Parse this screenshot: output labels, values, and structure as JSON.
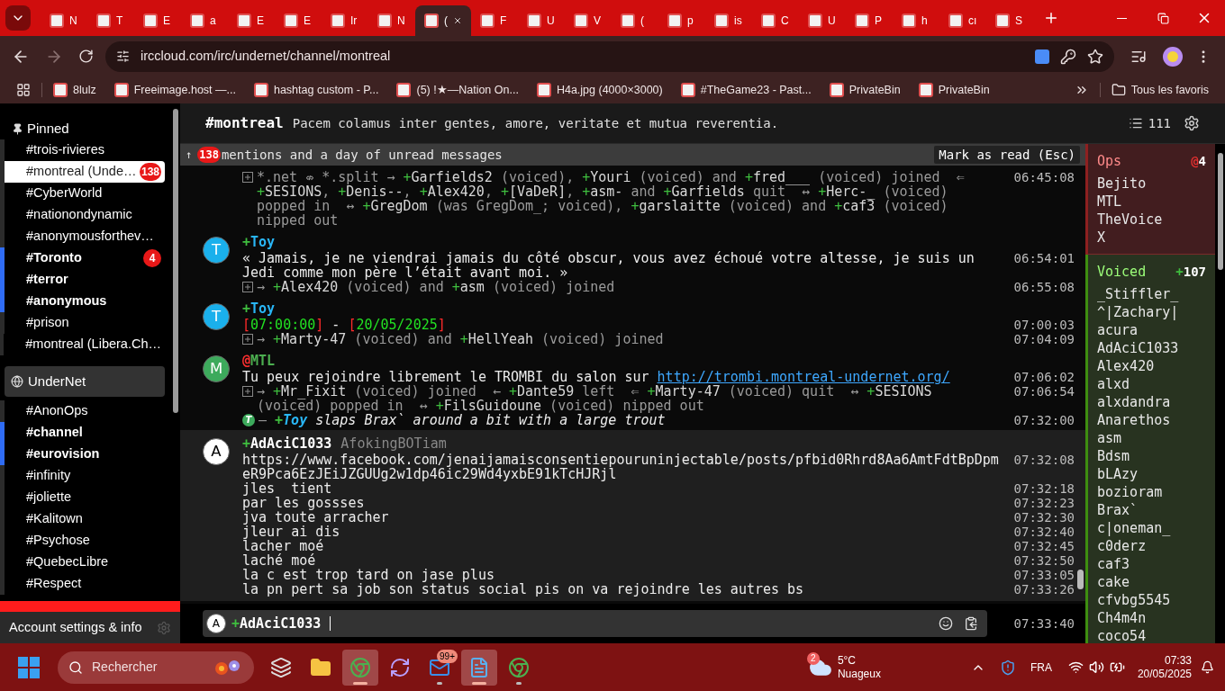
{
  "browser": {
    "tabs": [
      {
        "label": "N",
        "selected": false
      },
      {
        "label": "T",
        "selected": false
      },
      {
        "label": "E",
        "selected": false
      },
      {
        "label": "a",
        "selected": false
      },
      {
        "label": "E",
        "selected": false
      },
      {
        "label": "E",
        "selected": false
      },
      {
        "label": "Ir",
        "selected": false
      },
      {
        "label": "N",
        "selected": false
      },
      {
        "label": "(",
        "selected": true
      },
      {
        "label": "F",
        "selected": false
      },
      {
        "label": "U",
        "selected": false
      },
      {
        "label": "V",
        "selected": false
      },
      {
        "label": "(",
        "selected": false
      },
      {
        "label": "p",
        "selected": false
      },
      {
        "label": "is",
        "selected": false
      },
      {
        "label": "C",
        "selected": false
      },
      {
        "label": "U",
        "selected": false
      },
      {
        "label": "P",
        "selected": false
      },
      {
        "label": "h",
        "selected": false
      },
      {
        "label": "cı",
        "selected": false
      },
      {
        "label": "S",
        "selected": false
      }
    ],
    "address": "irccloud.com/irc/undernet/channel/montreal",
    "bookmarks": [
      "8lulz",
      "Freeimage.host —...",
      "hashtag custom - P...",
      "(5) !★—Nation On...",
      "H4a.jpg (4000×3000)",
      "#TheGame23 - Past...",
      "PrivateBin",
      "PrivateBin"
    ],
    "all_bookmarks": "Tous les favoris"
  },
  "sidebar": {
    "pinned_title": "Pinned",
    "pinned": [
      {
        "name": "#trois-rivieres",
        "bold": false,
        "selected": false
      },
      {
        "name": "#montreal (Unde…",
        "bold": false,
        "selected": true,
        "badge": "138"
      },
      {
        "name": "#CyberWorld",
        "bold": false,
        "selected": false
      },
      {
        "name": "#nationondynamic",
        "bold": false,
        "selected": false
      },
      {
        "name": "#anonymousforthev…",
        "bold": false,
        "selected": false
      },
      {
        "name": "#Toronto",
        "bold": true,
        "selected": false,
        "badge": "4"
      },
      {
        "name": "#terror",
        "bold": true,
        "selected": false
      },
      {
        "name": "#anonymous",
        "bold": true,
        "selected": false
      },
      {
        "name": "#prison",
        "bold": false,
        "selected": false
      },
      {
        "name": "#montreal (Libera.Ch…",
        "bold": false,
        "selected": false
      }
    ],
    "network": "UnderNet",
    "channels": [
      {
        "name": "#AnonOps",
        "bold": false,
        "selected": false
      },
      {
        "name": "#channel",
        "bold": true,
        "selected": false
      },
      {
        "name": "#eurovision",
        "bold": true,
        "selected": false
      },
      {
        "name": "#infinity",
        "bold": false,
        "selected": false
      },
      {
        "name": "#joliette",
        "bold": false,
        "selected": false
      },
      {
        "name": "#Kalitown",
        "bold": false,
        "selected": false
      },
      {
        "name": "#Psychose",
        "bold": false,
        "selected": false
      },
      {
        "name": "#QuebecLibre",
        "bold": false,
        "selected": false
      },
      {
        "name": "#Respect",
        "bold": false,
        "selected": false
      }
    ],
    "footer": "Account settings & info"
  },
  "channel": {
    "name": "#montreal",
    "topic": "Pacem colamus inter gentes, amore, veritate et mutua reverentia.",
    "member_count": "111"
  },
  "unread_banner": {
    "arrow": "↑",
    "count": "138",
    "text": "mentions and a day of unread messages",
    "button": "Mark as read (Esc)"
  },
  "messages": [
    {
      "highlighted": false,
      "lines": [
        {
          "kind": "event",
          "time": "06:45:08",
          "segments": [
            {
              "kind": "dim",
              "text": "*.net ⇎ *.split → "
            },
            {
              "kind": "voiced",
              "mode": "+",
              "text": "Garfields2"
            },
            {
              "kind": "dim",
              "text": " (voiced), "
            },
            {
              "kind": "voiced",
              "mode": "+",
              "text": "Youri"
            },
            {
              "kind": "dim",
              "text": " (voiced) and "
            },
            {
              "kind": "voiced",
              "mode": "+",
              "text": "fred___"
            },
            {
              "kind": "dim",
              "text": " (voiced) joined  ⇐ "
            },
            {
              "kind": "voiced",
              "mode": "+",
              "text": "SESIONS"
            },
            {
              "kind": "dim",
              "text": ", "
            },
            {
              "kind": "voiced",
              "mode": "+",
              "text": "Denis--"
            },
            {
              "kind": "dim",
              "text": ", "
            },
            {
              "kind": "voiced",
              "mode": "+",
              "text": "Alex420"
            },
            {
              "kind": "dim",
              "text": ", "
            },
            {
              "kind": "voiced",
              "mode": "+",
              "text": "[VaDeR]"
            },
            {
              "kind": "dim",
              "text": ", "
            },
            {
              "kind": "voiced",
              "mode": "+",
              "text": "asm-"
            },
            {
              "kind": "dim",
              "text": " and "
            },
            {
              "kind": "voiced",
              "mode": "+",
              "text": "Garfields"
            },
            {
              "kind": "dim",
              "text": " quit  ↔ "
            },
            {
              "kind": "voiced",
              "mode": "+",
              "text": "Herc-_"
            },
            {
              "kind": "dim",
              "text": " (voiced) popped in  ↔ "
            },
            {
              "kind": "voiced",
              "mode": "+",
              "text": "GregDom"
            },
            {
              "kind": "dim",
              "text": " (was GregDom_; voiced), "
            },
            {
              "kind": "voiced",
              "mode": "+",
              "text": "garslaitte"
            },
            {
              "kind": "dim",
              "text": " (voiced) and "
            },
            {
              "kind": "voiced",
              "mode": "+",
              "text": "caf3"
            },
            {
              "kind": "dim",
              "text": " (voiced) nipped out"
            }
          ]
        }
      ]
    },
    {
      "highlighted": false,
      "avatar": {
        "letter": "T",
        "color": "#1ab0ec"
      },
      "author": {
        "mode": {
          "text": "+",
          "color": "#3fbf3f"
        },
        "name": "Toy",
        "color": "#29b6f6"
      },
      "lines": [
        {
          "kind": "message",
          "time": "06:54:01",
          "segments": [
            {
              "kind": "text",
              "text": "« Jamais, je ne viendrai jamais du côté obscur, vous avez échoué votre altesse, je suis un Jedi comme mon père l’était avant moi. »"
            }
          ]
        },
        {
          "kind": "event",
          "time": "06:55:08",
          "segments": [
            {
              "kind": "dim",
              "text": "→ "
            },
            {
              "kind": "voiced",
              "mode": "+",
              "text": "Alex420"
            },
            {
              "kind": "dim",
              "text": " (voiced) and "
            },
            {
              "kind": "voiced",
              "mode": "+",
              "text": "asm"
            },
            {
              "kind": "dim",
              "text": " (voiced) joined"
            }
          ]
        }
      ]
    },
    {
      "highlighted": false,
      "avatar": {
        "letter": "T",
        "color": "#1ab0ec"
      },
      "author": {
        "mode": {
          "text": "+",
          "color": "#3fbf3f"
        },
        "name": "Toy",
        "color": "#29b6f6"
      },
      "lines": [
        {
          "kind": "message",
          "time": "07:00:03",
          "segments": [
            {
              "kind": "red",
              "text": "["
            },
            {
              "kind": "green",
              "text": "07:00:00"
            },
            {
              "kind": "red",
              "text": "]"
            },
            {
              "kind": "text",
              "text": " - "
            },
            {
              "kind": "red",
              "text": "["
            },
            {
              "kind": "green",
              "text": "20/05/2025"
            },
            {
              "kind": "red",
              "text": "]"
            }
          ]
        },
        {
          "kind": "event",
          "time": "07:04:09",
          "segments": [
            {
              "kind": "dim",
              "text": "→ "
            },
            {
              "kind": "voiced",
              "mode": "+",
              "text": "Marty-47"
            },
            {
              "kind": "dim",
              "text": " (voiced) and "
            },
            {
              "kind": "voiced",
              "mode": "+",
              "text": "HellYeah"
            },
            {
              "kind": "dim",
              "text": " (voiced) joined"
            }
          ]
        }
      ]
    },
    {
      "highlighted": false,
      "avatar": {
        "letter": "M",
        "color": "#3daa5c"
      },
      "author": {
        "mode": {
          "text": "@",
          "color": "#ff3030"
        },
        "name": "MTL",
        "color": "#4caf50"
      },
      "lines": [
        {
          "kind": "message",
          "time": "07:06:02",
          "segments": [
            {
              "kind": "text",
              "text": "Tu peux rejoindre librement le TROMBI du salon sur "
            },
            {
              "kind": "link",
              "text": "http://trombi.montreal-undernet.org/"
            }
          ]
        },
        {
          "kind": "event",
          "time": "07:06:54",
          "segments": [
            {
              "kind": "dim",
              "text": "→ "
            },
            {
              "kind": "voiced",
              "mode": "+",
              "text": "Mr_Fixit"
            },
            {
              "kind": "dim",
              "text": " (voiced) joined  ← "
            },
            {
              "kind": "voiced",
              "mode": "+",
              "text": "Dante59"
            },
            {
              "kind": "dim",
              "text": " left  ⇐ "
            },
            {
              "kind": "voiced",
              "mode": "+",
              "text": "Marty-47"
            },
            {
              "kind": "dim",
              "text": " (voiced) quit  ↔ "
            },
            {
              "kind": "voiced",
              "mode": "+",
              "text": "SESIONS"
            },
            {
              "kind": "dim",
              "text": " (voiced) popped in  ↔ "
            },
            {
              "kind": "voiced",
              "mode": "+",
              "text": "FilsGuidoune"
            },
            {
              "kind": "dim",
              "text": " (voiced) nipped out"
            }
          ]
        },
        {
          "kind": "action",
          "badge": "T",
          "time": "07:32:00",
          "segments": [
            {
              "kind": "dim",
              "text": "— "
            },
            {
              "kind": "action_nick",
              "mode": "+",
              "text": "Toy"
            },
            {
              "kind": "action",
              "text": " slaps Brax` around a bit with a large trout"
            }
          ]
        }
      ]
    },
    {
      "highlighted": true,
      "avatar": {
        "letter": "A",
        "color": "#ffffff"
      },
      "author": {
        "mode": {
          "text": "+",
          "color": "#3fbf3f"
        },
        "name": "AdAciC1033",
        "color": "#ffffff"
      },
      "realname": "AfokingBOTiam",
      "lines": [
        {
          "kind": "message",
          "time": "07:32:08",
          "segments": [
            {
              "kind": "text",
              "text": "https://www.facebook.com/jenaijamaisconsentiepouruninjectable/posts/pfbid0Rhrd8Aa6AmtFdtBpDpmeR9Pca6EzJEiJZGUUg2w1dp46ic29Wd4yxbE91kTcHJRjl"
            }
          ]
        },
        {
          "kind": "message",
          "time": "07:32:18",
          "segments": [
            {
              "kind": "text",
              "text": "jles  tient"
            }
          ]
        },
        {
          "kind": "message",
          "time": "07:32:23",
          "segments": [
            {
              "kind": "text",
              "text": "par les gossses"
            }
          ]
        },
        {
          "kind": "message",
          "time": "07:32:30",
          "segments": [
            {
              "kind": "text",
              "text": "jva toute arracher"
            }
          ]
        },
        {
          "kind": "message",
          "time": "07:32:40",
          "segments": [
            {
              "kind": "text",
              "text": "jleur ai dis"
            }
          ]
        },
        {
          "kind": "message",
          "time": "07:32:45",
          "segments": [
            {
              "kind": "text",
              "text": "lacher moé"
            }
          ]
        },
        {
          "kind": "message",
          "time": "07:32:50",
          "segments": [
            {
              "kind": "text",
              "text": "laché moé"
            }
          ]
        },
        {
          "kind": "message",
          "time": "07:33:05",
          "segments": [
            {
              "kind": "text",
              "text": "la c est trop tard on jase plus"
            }
          ]
        },
        {
          "kind": "message",
          "time": "07:33:26",
          "segments": [
            {
              "kind": "text",
              "text": "la pn pert sa job son status social pis on va rejoindre les autres bs"
            }
          ]
        }
      ]
    }
  ],
  "input": {
    "avatar": {
      "letter": "A",
      "color": "#ffffff"
    },
    "mode": "+",
    "nick": "AdAciC1033",
    "time": "07:33:40"
  },
  "userlist": [
    {
      "kind": "ops",
      "title": "Ops",
      "mode": "@",
      "count": "4",
      "members": [
        "Bejito",
        "MTL",
        "TheVoice",
        "X"
      ]
    },
    {
      "kind": "voiced",
      "title": "Voiced",
      "mode": "+",
      "count": "107",
      "members": [
        "_Stiffler_",
        "^|Zachary|",
        "acura",
        "AdAciC1033",
        "Alex420",
        "alxd",
        "alxdandra",
        "Anarethos",
        "asm",
        "Bdsm",
        "bLAzy",
        "bozioram",
        "Brax`",
        "c|oneman_",
        "c0derz",
        "caf3",
        "cake",
        "cfvbg5545",
        "Ch4m4n",
        "coco54"
      ]
    }
  ],
  "taskbar": {
    "search_placeholder": "Rechercher",
    "apps": [
      {
        "kind": "task-view",
        "open": false,
        "active": false
      },
      {
        "kind": "folder",
        "open": false,
        "active": false
      },
      {
        "kind": "browser",
        "open": true,
        "active": true
      },
      {
        "kind": "sync",
        "open": false,
        "active": false
      },
      {
        "kind": "mail",
        "open": true,
        "active": false,
        "badge": "99+"
      },
      {
        "kind": "notepad",
        "open": true,
        "active": true
      },
      {
        "kind": "browser",
        "open": true,
        "active": false
      }
    ],
    "weather_badge": "2",
    "temperature": "5°C",
    "weather": "Nuageux",
    "language": "FRA",
    "time": "07:33",
    "date": "20/05/2025"
  }
}
